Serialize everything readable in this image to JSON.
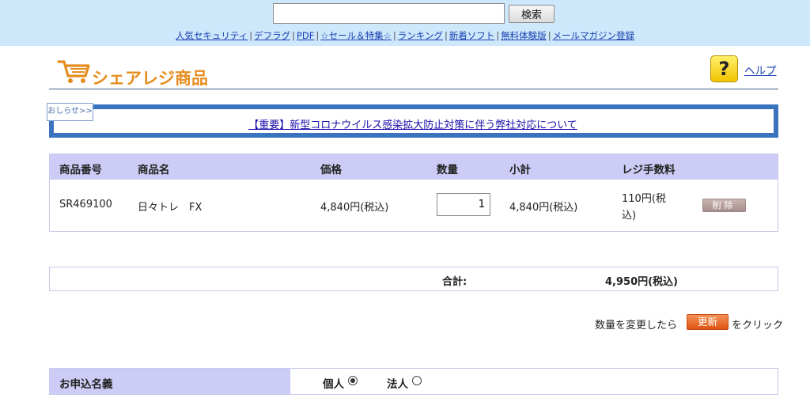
{
  "search": {
    "value": "",
    "button_label": "検索"
  },
  "top_links": [
    "人気セキュリティ",
    "デフラグ",
    "PDF",
    "☆セール＆特集☆",
    "ランキング",
    "新着ソフト",
    "無料体験版",
    "メールマガジン登録"
  ],
  "header": {
    "logo_text": "シェアレジ商品",
    "help_label": "ヘルプ",
    "help_icon_glyph": "?"
  },
  "notice": {
    "tab_label": "おしらせ>>",
    "link_text": "【重要】新型コロナウイルス感染拡大防止対策に伴う弊社対応について"
  },
  "cart": {
    "columns": [
      "商品番号",
      "商品名",
      "価格",
      "数量",
      "小計",
      "レジ手数料"
    ],
    "items": [
      {
        "product_no": "SR469100",
        "name": "日々トレ　FX",
        "price": "4,840円(税込)",
        "quantity": "1",
        "subtotal": "4,840円(税込)",
        "fee_line1": "110円(税",
        "fee_line2": "込)",
        "delete_label": "削除"
      }
    ]
  },
  "total": {
    "label": "合計:",
    "value": "4,950円(税込)"
  },
  "update": {
    "before": "数量を変更したら",
    "button": "更新",
    "after": "をクリック"
  },
  "applicant": {
    "label": "お申込名義",
    "options": [
      {
        "label": "個人",
        "checked": true
      },
      {
        "label": "法人",
        "checked": false
      }
    ]
  },
  "colors": {
    "top_bar": "#cde7fb",
    "header_bg": "#ccccf6",
    "notice_border": "#3a73be",
    "logo_orange": "#e58d1e",
    "update_button": "#e86a2a"
  }
}
